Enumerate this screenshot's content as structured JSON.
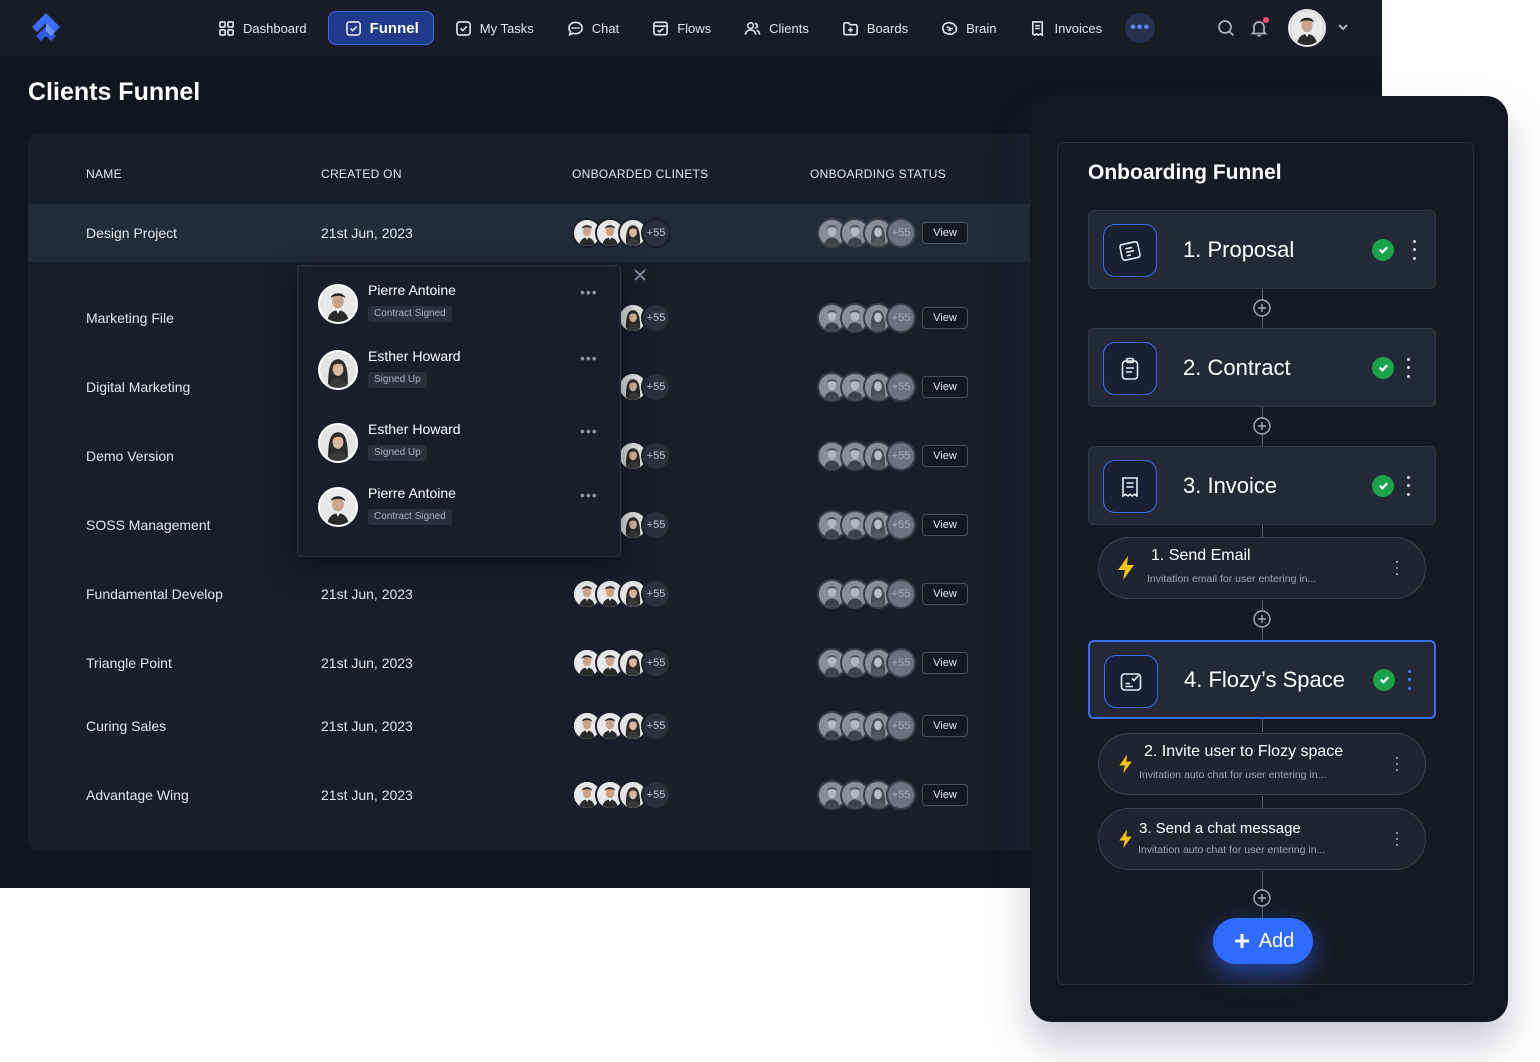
{
  "nav": {
    "items": [
      {
        "label": "Dashboard",
        "icon": "grid-icon"
      },
      {
        "label": "Funnel",
        "icon": "check-square-icon",
        "active": true
      },
      {
        "label": "My Tasks",
        "icon": "check-square-icon"
      },
      {
        "label": "Chat",
        "icon": "chat-bubble-icon"
      },
      {
        "label": "Flows",
        "icon": "window-icon"
      },
      {
        "label": "Clients",
        "icon": "users-icon"
      },
      {
        "label": "Boards",
        "icon": "folder-plus-icon"
      },
      {
        "label": "Brain",
        "icon": "brain-icon"
      },
      {
        "label": "Invoices",
        "icon": "invoice-icon"
      }
    ],
    "more": "•••"
  },
  "page": {
    "title": "Clients Funnel"
  },
  "table": {
    "headers": {
      "name": "NAME",
      "created": "CREATED ON",
      "onboarded": "ONBOARDED CLINETS",
      "status": "ONBOARDING STATUS"
    },
    "more_count": "+55",
    "view_label": "View",
    "rows": [
      {
        "name": "Design Project",
        "created": "21st Jun, 2023"
      },
      {
        "name": "Marketing File",
        "created": ""
      },
      {
        "name": "Digital Marketing",
        "created": ""
      },
      {
        "name": "Demo Version",
        "created": ""
      },
      {
        "name": "SOSS Management",
        "created": ""
      },
      {
        "name": "Fundamental Develop",
        "created": "21st Jun, 2023"
      },
      {
        "name": "Triangle Point",
        "created": "21st Jun, 2023"
      },
      {
        "name": "Curing Sales",
        "created": "21st Jun, 2023"
      },
      {
        "name": "Advantage Wing",
        "created": "21st Jun, 2023"
      }
    ]
  },
  "popover": {
    "items": [
      {
        "name": "Pierre Antoine",
        "status": "Contract Signed"
      },
      {
        "name": "Esther Howard",
        "status": "Signed Up"
      },
      {
        "name": "Esther Howard",
        "status": "Signed Up"
      },
      {
        "name": "Pierre Antoine",
        "status": "Contract Signed"
      }
    ],
    "dots": "•••"
  },
  "funnel": {
    "title": "Onboarding Funnel",
    "steps": [
      {
        "label": "1. Proposal",
        "icon": "proposal-icon",
        "done": true
      },
      {
        "label": "2. Contract",
        "icon": "clipboard-icon",
        "done": true
      },
      {
        "label": "3. Invoice",
        "icon": "invoice-icon",
        "done": true
      },
      {
        "label": "4. Flozy’s Space",
        "icon": "space-icon",
        "done": true
      }
    ],
    "actions": [
      {
        "title": "1. Send Email",
        "subtitle": "Invitation email for user entering  in..."
      },
      {
        "title": "2. Invite user to Flozy space",
        "subtitle": "Invitation auto chat for user entering  in..."
      },
      {
        "title": "3. Send a chat message",
        "subtitle": "Invitation auto chat for user entering  in..."
      }
    ],
    "add_label": "Add"
  },
  "colors": {
    "accent": "#3b6cf6",
    "success": "#1aa34a",
    "background": "#12151d",
    "bolt": "#f5c518"
  }
}
